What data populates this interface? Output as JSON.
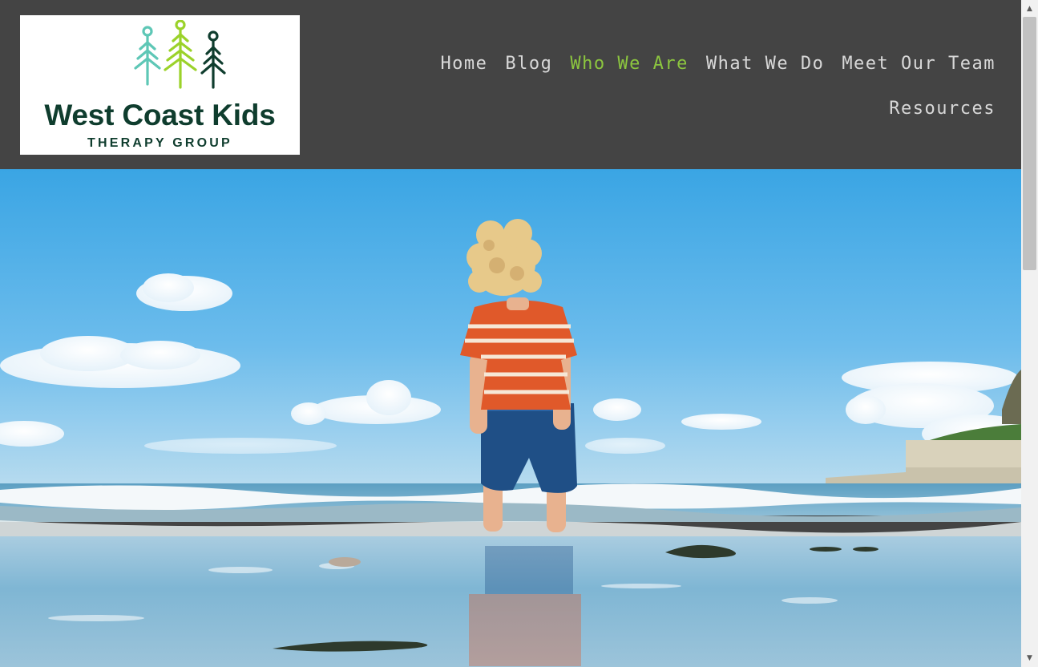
{
  "logo": {
    "name": "West Coast Kids",
    "tagline": "THERAPY GROUP",
    "colors": {
      "tree_left": "#5ec7b6",
      "tree_middle": "#9bd22a",
      "tree_right": "#0f3d2e",
      "text": "#0f3d2e"
    }
  },
  "nav": {
    "items": [
      {
        "label": "Home"
      },
      {
        "label": "Blog"
      },
      {
        "label": "Who We Are",
        "active": true
      },
      {
        "label": "What We Do"
      },
      {
        "label": "Meet Our Team"
      },
      {
        "label": "Resources"
      }
    ],
    "colors": {
      "default": "#d8d8d8",
      "active": "#8cc63f",
      "background": "#444444"
    }
  },
  "hero": {
    "image": "child-standing-in-ocean-waves-on-beach",
    "colors": {
      "sky": "#4eaee6",
      "sea": "#6fa8c4",
      "shirt": "#e0592a",
      "shorts": "#1f4f86"
    }
  },
  "scrollbar": {
    "up_icon": "triangle-up-icon",
    "down_icon": "triangle-down-icon",
    "up_glyph": "▲",
    "down_glyph": "▼"
  }
}
